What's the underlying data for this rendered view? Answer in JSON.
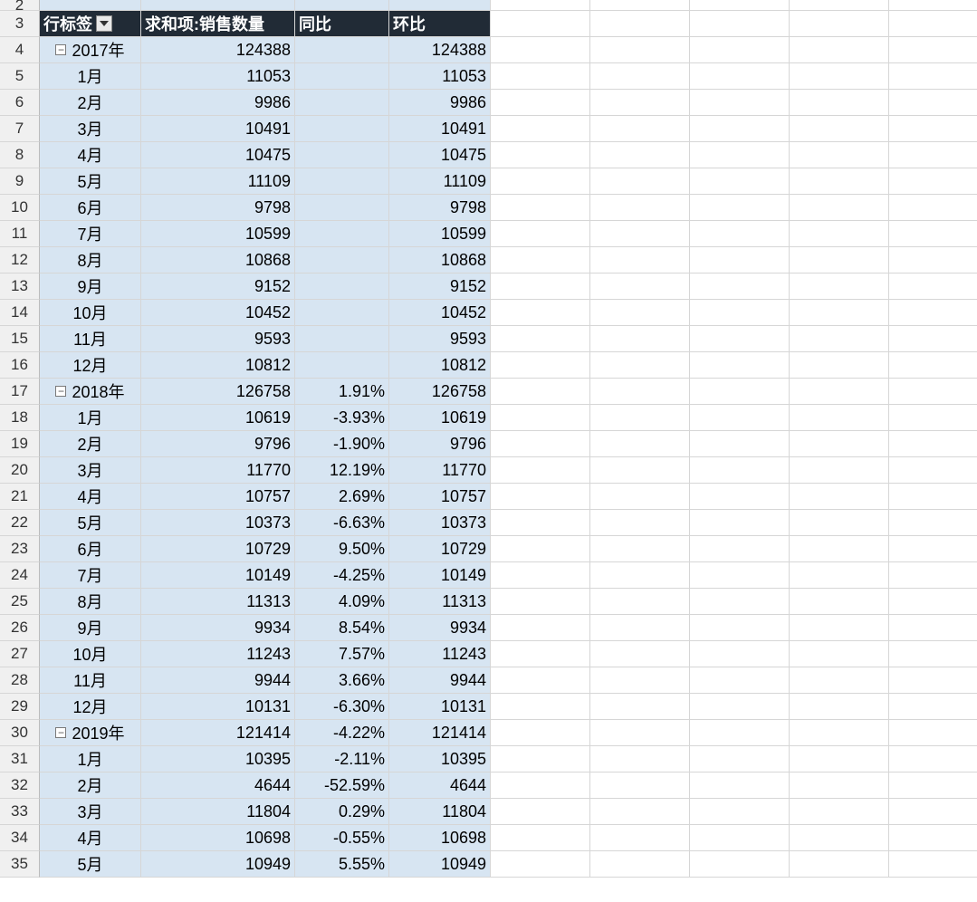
{
  "header": {
    "label_col": "行标签",
    "sum_col": "求和项:销售数量",
    "yoy_col": "同比",
    "mom_col": "环比"
  },
  "startRowNumber": 2,
  "groups": [
    {
      "title": "2017年",
      "sum": "124388",
      "yoy": "",
      "mom": "124388",
      "rows": [
        {
          "label": "1月",
          "sum": "11053",
          "yoy": "",
          "mom": "11053"
        },
        {
          "label": "2月",
          "sum": "9986",
          "yoy": "",
          "mom": "9986"
        },
        {
          "label": "3月",
          "sum": "10491",
          "yoy": "",
          "mom": "10491"
        },
        {
          "label": "4月",
          "sum": "10475",
          "yoy": "",
          "mom": "10475"
        },
        {
          "label": "5月",
          "sum": "11109",
          "yoy": "",
          "mom": "11109"
        },
        {
          "label": "6月",
          "sum": "9798",
          "yoy": "",
          "mom": "9798"
        },
        {
          "label": "7月",
          "sum": "10599",
          "yoy": "",
          "mom": "10599"
        },
        {
          "label": "8月",
          "sum": "10868",
          "yoy": "",
          "mom": "10868"
        },
        {
          "label": "9月",
          "sum": "9152",
          "yoy": "",
          "mom": "9152"
        },
        {
          "label": "10月",
          "sum": "10452",
          "yoy": "",
          "mom": "10452"
        },
        {
          "label": "11月",
          "sum": "9593",
          "yoy": "",
          "mom": "9593"
        },
        {
          "label": "12月",
          "sum": "10812",
          "yoy": "",
          "mom": "10812"
        }
      ]
    },
    {
      "title": "2018年",
      "sum": "126758",
      "yoy": "1.91%",
      "mom": "126758",
      "rows": [
        {
          "label": "1月",
          "sum": "10619",
          "yoy": "-3.93%",
          "mom": "10619"
        },
        {
          "label": "2月",
          "sum": "9796",
          "yoy": "-1.90%",
          "mom": "9796"
        },
        {
          "label": "3月",
          "sum": "11770",
          "yoy": "12.19%",
          "mom": "11770"
        },
        {
          "label": "4月",
          "sum": "10757",
          "yoy": "2.69%",
          "mom": "10757"
        },
        {
          "label": "5月",
          "sum": "10373",
          "yoy": "-6.63%",
          "mom": "10373"
        },
        {
          "label": "6月",
          "sum": "10729",
          "yoy": "9.50%",
          "mom": "10729"
        },
        {
          "label": "7月",
          "sum": "10149",
          "yoy": "-4.25%",
          "mom": "10149"
        },
        {
          "label": "8月",
          "sum": "11313",
          "yoy": "4.09%",
          "mom": "11313"
        },
        {
          "label": "9月",
          "sum": "9934",
          "yoy": "8.54%",
          "mom": "9934"
        },
        {
          "label": "10月",
          "sum": "11243",
          "yoy": "7.57%",
          "mom": "11243"
        },
        {
          "label": "11月",
          "sum": "9944",
          "yoy": "3.66%",
          "mom": "9944"
        },
        {
          "label": "12月",
          "sum": "10131",
          "yoy": "-6.30%",
          "mom": "10131"
        }
      ]
    },
    {
      "title": "2019年",
      "sum": "121414",
      "yoy": "-4.22%",
      "mom": "121414",
      "rows": [
        {
          "label": "1月",
          "sum": "10395",
          "yoy": "-2.11%",
          "mom": "10395"
        },
        {
          "label": "2月",
          "sum": "4644",
          "yoy": "-52.59%",
          "mom": "4644"
        },
        {
          "label": "3月",
          "sum": "11804",
          "yoy": "0.29%",
          "mom": "11804"
        },
        {
          "label": "4月",
          "sum": "10698",
          "yoy": "-0.55%",
          "mom": "10698"
        },
        {
          "label": "5月",
          "sum": "10949",
          "yoy": "5.55%",
          "mom": "10949"
        }
      ]
    }
  ],
  "collapseGlyph": "−"
}
